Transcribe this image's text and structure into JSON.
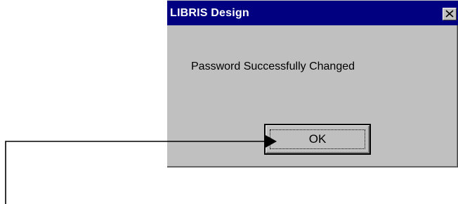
{
  "dialog": {
    "title": "LIBRIS Design",
    "message": "Password Successfully Changed",
    "ok_label": "OK",
    "close_icon": "close-icon"
  },
  "colors": {
    "titlebar": "#000080",
    "dialog_face": "#c0c0c0",
    "title_text": "#ffffff"
  },
  "annotation": {
    "icon": "arrow-pointer-icon",
    "target": "ok-button"
  }
}
